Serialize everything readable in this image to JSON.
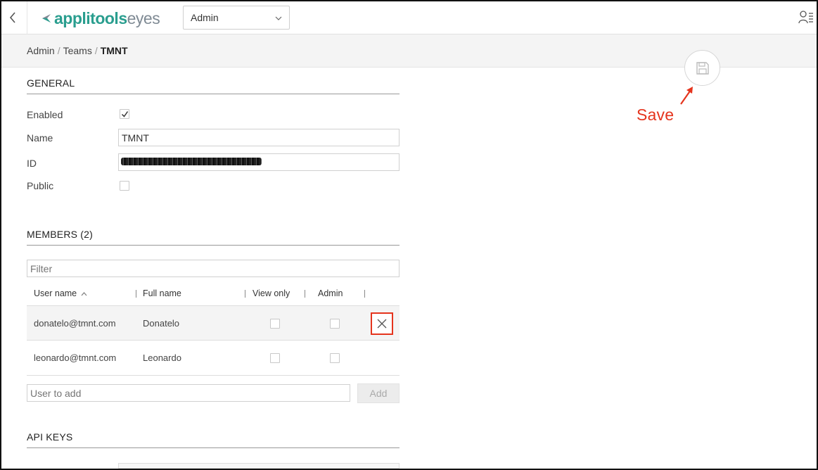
{
  "header": {
    "logo_brand": "applitools",
    "logo_product": "eyes",
    "org_select_value": "Admin"
  },
  "breadcrumb": {
    "items": [
      "Admin",
      "Teams"
    ],
    "current": "TMNT"
  },
  "general": {
    "title": "GENERAL",
    "enabled_label": "Enabled",
    "enabled": true,
    "name_label": "Name",
    "name_value": "TMNT",
    "id_label": "ID",
    "public_label": "Public",
    "public": false
  },
  "members": {
    "title": "MEMBERS (2)",
    "filter_placeholder": "Filter",
    "columns": {
      "user_name": "User name",
      "full_name": "Full name",
      "view_only": "View only",
      "admin": "Admin"
    },
    "rows": [
      {
        "user_name": "donatelo@tmnt.com",
        "full_name": "Donatelo",
        "view_only": false,
        "admin": false
      },
      {
        "user_name": "leonardo@tmnt.com",
        "full_name": "Leonardo",
        "view_only": false,
        "admin": false
      }
    ],
    "add_placeholder": "User to add",
    "add_label": "Add"
  },
  "api_keys": {
    "title": "API KEYS"
  },
  "annotation": {
    "save_label": "Save",
    "color": "#e5341d"
  },
  "icons": {
    "back": "chevron-left-icon",
    "user": "user-list-icon",
    "save": "floppy-disk-icon",
    "delete": "close-icon",
    "dropdown": "chevron-down-icon",
    "sort": "chevron-up-icon"
  },
  "colors": {
    "brand": "#2a9e8f",
    "highlight": "#e5341d"
  }
}
